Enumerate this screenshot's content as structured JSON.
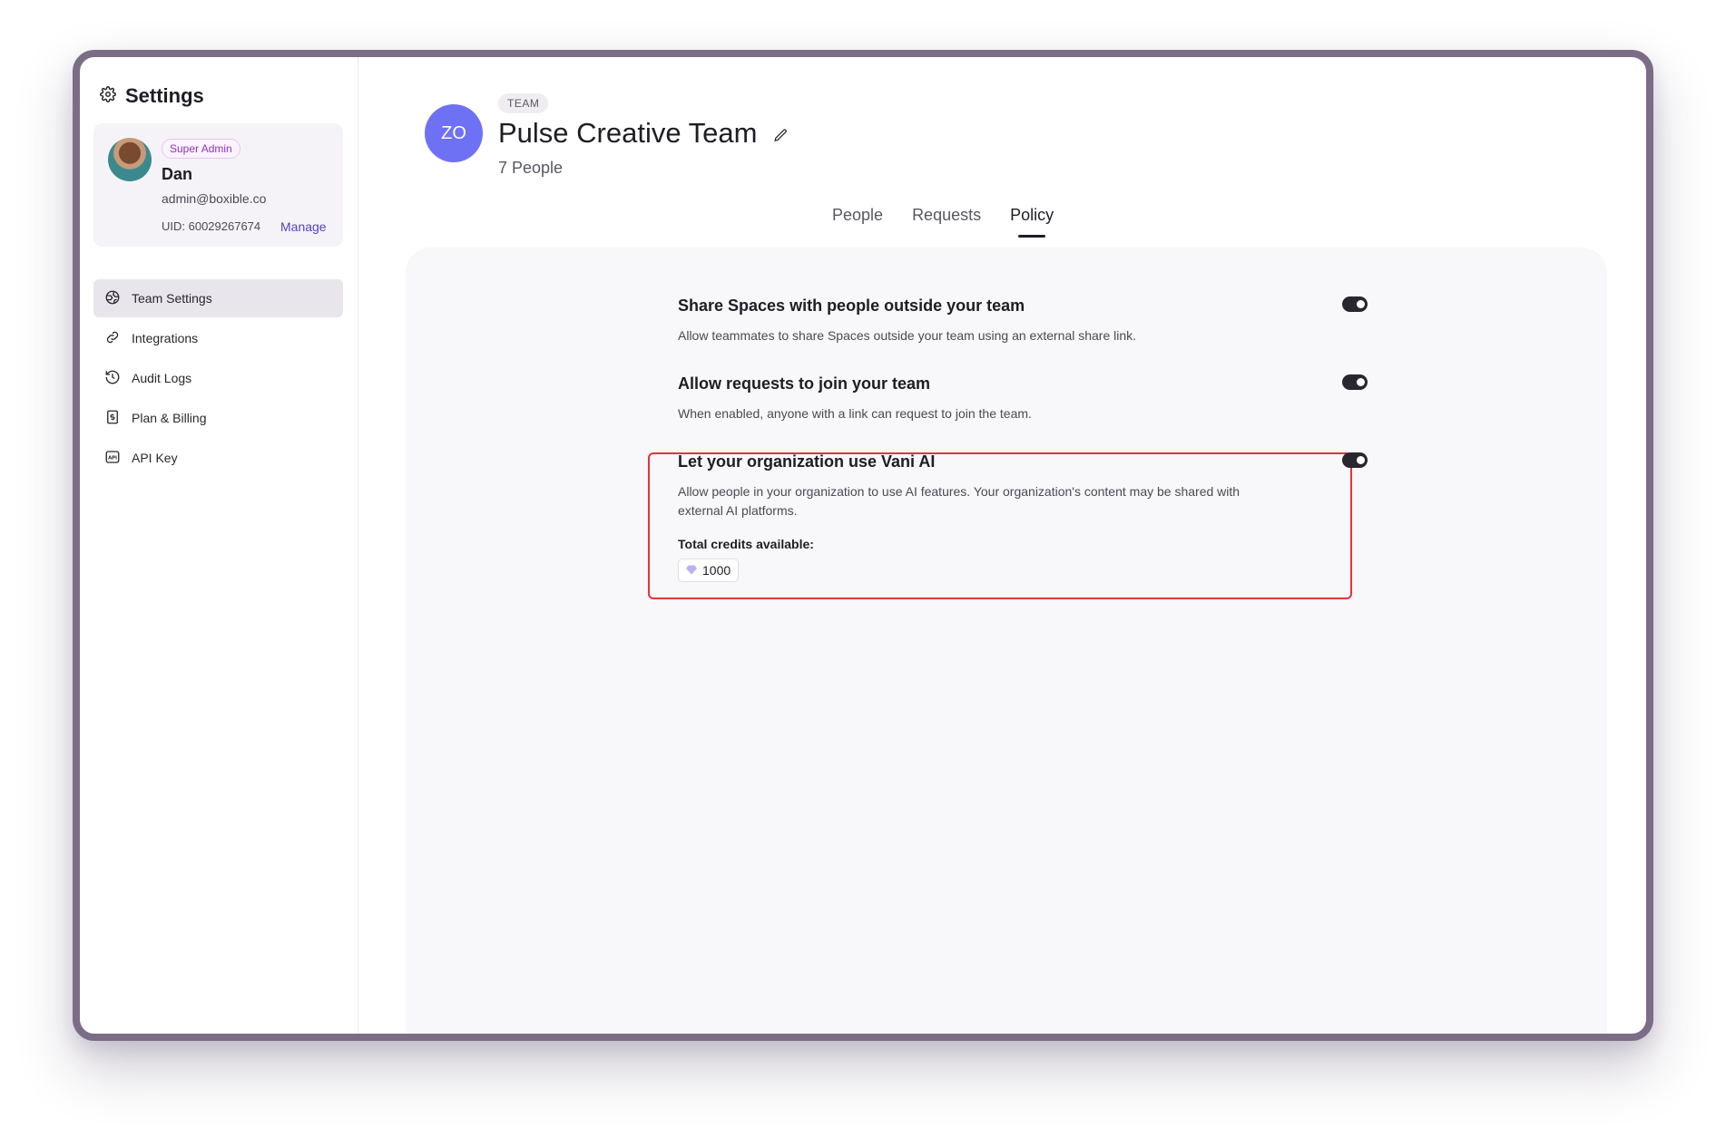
{
  "sidebar": {
    "title": "Settings",
    "title_icon": "gear-icon",
    "profile": {
      "role": "Super Admin",
      "name": "Dan",
      "email": "admin@boxible.co",
      "uid": "UID: 60029267674",
      "manage_label": "Manage"
    },
    "items": [
      {
        "label": "Team Settings",
        "icon": "team-icon",
        "active": true
      },
      {
        "label": "Integrations",
        "icon": "link-icon",
        "active": false
      },
      {
        "label": "Audit Logs",
        "icon": "history-icon",
        "active": false
      },
      {
        "label": "Plan & Billing",
        "icon": "billing-icon",
        "active": false
      },
      {
        "label": "API Key",
        "icon": "api-icon",
        "active": false
      }
    ]
  },
  "team": {
    "initials": "ZO",
    "tag": "TEAM",
    "name": "Pulse Creative Team",
    "count": "7 People"
  },
  "tabs": [
    {
      "label": "People",
      "active": false
    },
    {
      "label": "Requests",
      "active": false
    },
    {
      "label": "Policy",
      "active": true
    }
  ],
  "policies": [
    {
      "title": "Share Spaces with people outside your team",
      "description": "Allow teammates to share Spaces outside your team using an external share link.",
      "enabled": true
    },
    {
      "title": "Allow requests to join your team",
      "description": "When enabled, anyone with a link can request to join the team.",
      "enabled": true
    },
    {
      "title": "Let your organization use Vani AI",
      "description": "Allow people in your organization to use AI features. Your organization's content may be shared with external AI platforms.",
      "enabled": true,
      "credits_label": "Total credits available:",
      "credits_value": "1000",
      "credits_icon": "diamond-icon"
    }
  ],
  "colors": {
    "accent": "#6f71f5",
    "highlight_border": "#e3343a",
    "window_border": "#7c6d87"
  }
}
